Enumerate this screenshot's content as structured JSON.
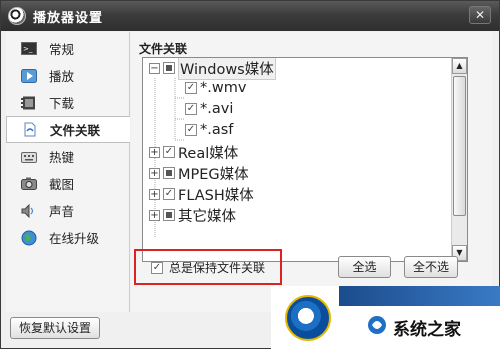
{
  "window": {
    "title": "播放器设置"
  },
  "sidebar": {
    "items": [
      {
        "label": "常规",
        "icon": "console-icon"
      },
      {
        "label": "播放",
        "icon": "play-icon"
      },
      {
        "label": "下载",
        "icon": "film-icon"
      },
      {
        "label": "文件关联",
        "icon": "file-link-icon",
        "active": true
      },
      {
        "label": "热键",
        "icon": "keyboard-icon"
      },
      {
        "label": "截图",
        "icon": "camera-icon"
      },
      {
        "label": "声音",
        "icon": "speaker-icon"
      },
      {
        "label": "在线升级",
        "icon": "globe-icon"
      }
    ]
  },
  "file_assoc": {
    "group_label": "文件关联",
    "tree": [
      {
        "label": "Windows媒体",
        "level": 0,
        "expander": "−",
        "checked": "partial"
      },
      {
        "label": "*.wmv",
        "level": 1,
        "checked": "checked"
      },
      {
        "label": "*.avi",
        "level": 1,
        "checked": "checked"
      },
      {
        "label": "*.asf",
        "level": 1,
        "checked": "checked"
      },
      {
        "label": "Real媒体",
        "level": 0,
        "expander": "+",
        "checked": "checked"
      },
      {
        "label": "MPEG媒体",
        "level": 0,
        "expander": "+",
        "checked": "partial"
      },
      {
        "label": "FLASH媒体",
        "level": 0,
        "expander": "+",
        "checked": "checked"
      },
      {
        "label": "其它媒体",
        "level": 0,
        "expander": "+",
        "checked": "partial"
      }
    ],
    "keep_assoc_label": "总是保持文件关联",
    "keep_assoc_checked": true,
    "select_all_label": "全选",
    "select_none_label": "全不选"
  },
  "footer": {
    "restore_label": "恢复默认设置"
  },
  "watermark": {
    "brand": "系统之家"
  },
  "colors": {
    "titlebar": "#3c3c3c",
    "highlight_box": "#dd2222",
    "watermark_blue": "#1c6fc2"
  }
}
